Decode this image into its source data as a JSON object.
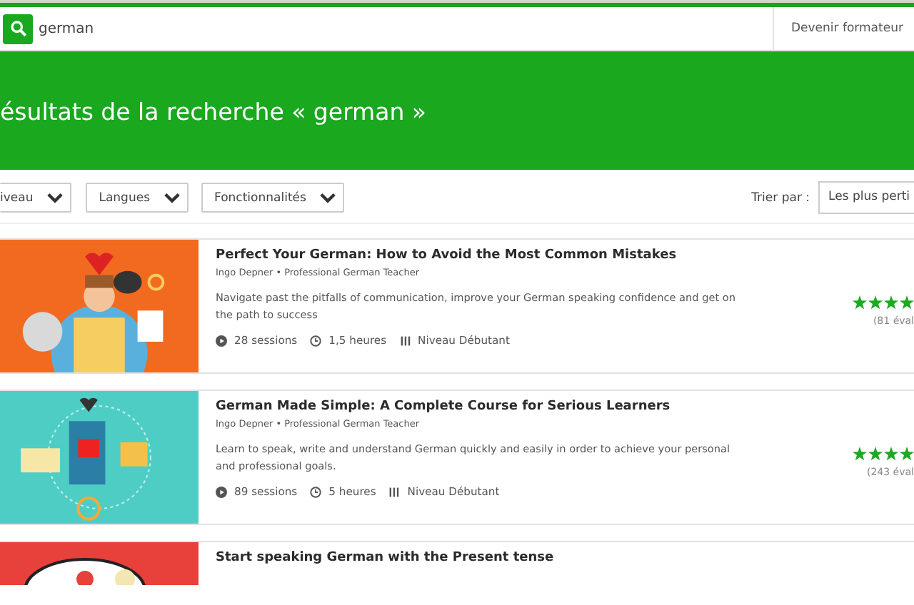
{
  "search": {
    "value": "german"
  },
  "header_link": "Devenir formateur",
  "banner": {
    "title": "ésultats de la recherche « german »"
  },
  "filters": [
    "iveau",
    "Langues",
    "Fonctionnalités"
  ],
  "sort": {
    "label": "Trier par :",
    "value": "Les plus perti"
  },
  "courses": [
    {
      "title": "Perfect Your German: How to Avoid the Most Common Mistakes",
      "author": "Ingo Depner • Professional German Teacher",
      "description": "Navigate past the pitfalls of communication, improve your German speaking confidence and get on the path to success",
      "sessions": "28 sessions",
      "duration": "1,5 heures",
      "level": "Niveau Débutant",
      "stars": 4,
      "reviews": "(81 éval"
    },
    {
      "title": "German Made Simple: A Complete Course for Serious Learners",
      "author": "Ingo Depner • Professional German Teacher",
      "description": "Learn to speak, write and understand German quickly and easily in order to achieve your personal and professional goals.",
      "sessions": "89 sessions",
      "duration": "5 heures",
      "level": "Niveau Débutant",
      "stars": 4,
      "reviews": "(243 éval"
    },
    {
      "title": "Start speaking German with the Present tense"
    }
  ]
}
